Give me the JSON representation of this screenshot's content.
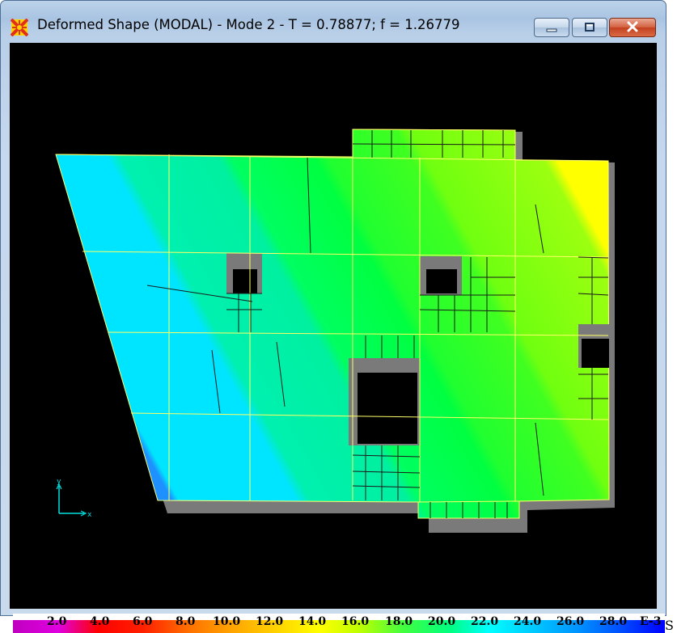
{
  "window": {
    "title": "Deformed Shape (MODAL) - Mode 2 - T = 0.78877;  f = 1.26779",
    "app_icon": "sap2000-icon",
    "controls": {
      "minimize": "minimize-icon",
      "maximize": "maximize-icon",
      "close": "close-icon"
    }
  },
  "viewport": {
    "background": "#000000",
    "axes": {
      "x_label": "x",
      "y_label": "y"
    }
  },
  "legend": {
    "labels": [
      "2.0",
      "4.0",
      "6.0",
      "8.0",
      "10.0",
      "12.0",
      "14.0",
      "16.0",
      "18.0",
      "20.0",
      "22.0",
      "24.0",
      "26.0",
      "28.0",
      "E-3"
    ],
    "units": "S",
    "colors": [
      "#c000c0",
      "#e000ff",
      "#ff0000",
      "#ff5000",
      "#ff9000",
      "#ffc000",
      "#ffff00",
      "#c0ff00",
      "#40ff40",
      "#00ff80",
      "#00ffff",
      "#00c8ff",
      "#0090ff",
      "#0040ff",
      "#0000ff"
    ]
  }
}
